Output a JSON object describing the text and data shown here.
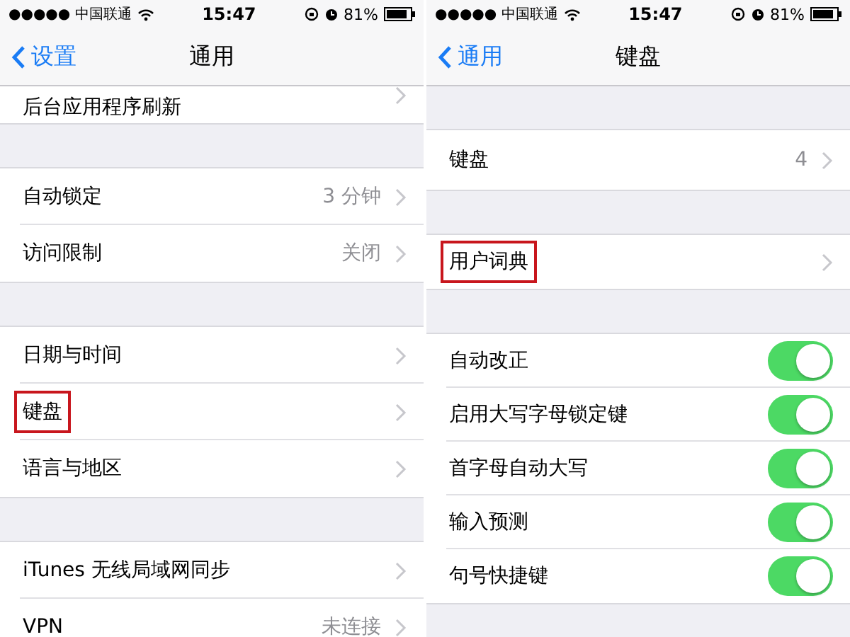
{
  "panels": [
    {
      "status_bar": {
        "carrier": "●●●●● 中国联通",
        "time": "15:47",
        "battery": "81%"
      },
      "nav": {
        "back": "设置",
        "title": "通用"
      },
      "groups": [
        {
          "partial": true,
          "rows": [
            {
              "kind": "chevron",
              "label": "后台应用程序刷新",
              "highlighted": false
            }
          ]
        },
        {
          "partial": false,
          "rows": [
            {
              "kind": "chevron",
              "label": "自动锁定",
              "value": "3 分钟",
              "highlighted": false
            },
            {
              "kind": "chevron",
              "label": "访问限制",
              "value": "关闭",
              "highlighted": false
            }
          ]
        },
        {
          "partial": false,
          "rows": [
            {
              "kind": "chevron",
              "label": "日期与时间",
              "highlighted": false
            },
            {
              "kind": "chevron",
              "label": "键盘",
              "highlighted": true
            },
            {
              "kind": "chevron",
              "label": "语言与地区",
              "highlighted": false
            }
          ]
        },
        {
          "partial": false,
          "rows": [
            {
              "kind": "chevron",
              "label": "iTunes 无线局域网同步",
              "highlighted": false
            },
            {
              "kind": "chevron",
              "label": "VPN",
              "value": "未连接",
              "highlighted": false
            }
          ]
        }
      ]
    },
    {
      "status_bar": {
        "carrier": "●●●●● 中国联通",
        "time": "15:47",
        "battery": "81%"
      },
      "nav": {
        "back": "通用",
        "title": "键盘"
      },
      "groups": [
        {
          "partial": false,
          "rows": [
            {
              "kind": "chevron",
              "label": "键盘",
              "value": "4",
              "highlighted": false
            }
          ]
        },
        {
          "partial": false,
          "rows": [
            {
              "kind": "chevron",
              "label": "用户词典",
              "highlighted": true
            }
          ]
        },
        {
          "partial": false,
          "rows": [
            {
              "kind": "toggle",
              "label": "自动改正",
              "on": true
            },
            {
              "kind": "toggle",
              "label": "启用大写字母锁定键",
              "on": true
            },
            {
              "kind": "toggle",
              "label": "首字母自动大写",
              "on": true
            },
            {
              "kind": "toggle",
              "label": "输入预测",
              "on": true
            },
            {
              "kind": "toggle",
              "label": "句号快捷键",
              "on": true
            }
          ]
        }
      ]
    }
  ]
}
